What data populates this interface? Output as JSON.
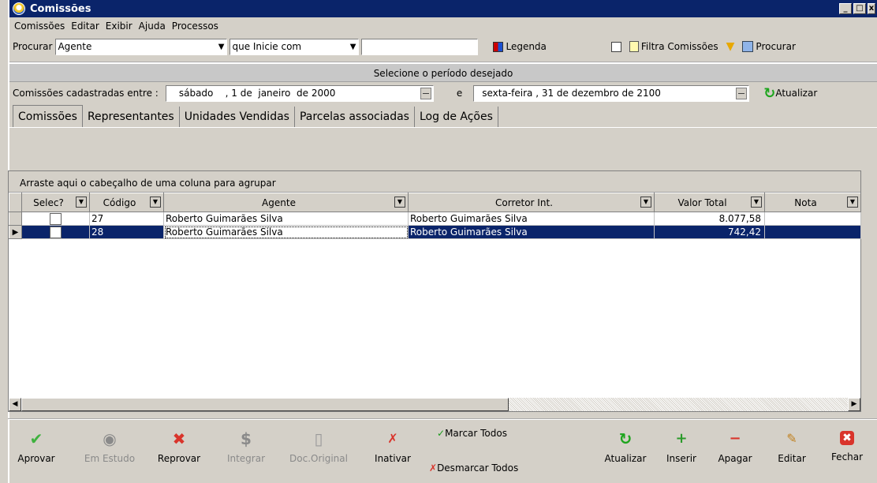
{
  "window": {
    "title": "Comissões"
  },
  "menu": [
    "Comissões",
    "Editar",
    "Exibir",
    "Ajuda",
    "Processos"
  ],
  "search": {
    "label": "Procurar",
    "field": "Agente",
    "condition": "que Inicie com",
    "value": "",
    "legend": "Legenda",
    "filter_label": "Filtra Comissões",
    "search_button": "Procurar"
  },
  "period": {
    "header": "Selecione o período desejado",
    "label": "Comissões cadastradas entre :",
    "from": "sábado    , 1 de  janeiro  de 2000",
    "connector": "e",
    "to": "sexta-feira , 31 de dezembro de 2100",
    "refresh": "Atualizar"
  },
  "tabs": [
    "Comissões",
    "Representantes",
    "Unidades Vendidas",
    "Parcelas associadas",
    "Log de Ações"
  ],
  "grid": {
    "group_hint": "Arraste aqui o cabeçalho de uma coluna para agrupar",
    "columns": [
      "Selec?",
      "Código",
      "Agente",
      "Corretor Int.",
      "Valor Total",
      "Nota"
    ],
    "rows": [
      {
        "codigo": "27",
        "agente": "Roberto Guimarães Silva",
        "corretor": "Roberto Guimarães Silva",
        "valor": "8.077,58",
        "nota": ""
      },
      {
        "codigo": "28",
        "agente": "Roberto Guimarães Silva",
        "corretor": "Roberto Guimarães Silva",
        "valor": "742,42",
        "nota": ""
      }
    ]
  },
  "toolbar": {
    "aprovar": "Aprovar",
    "em_estudo": "Em Estudo",
    "reprovar": "Reprovar",
    "integrar": "Integrar",
    "doc_original": "Doc.Original",
    "inativar": "Inativar",
    "marcar_todos": "Marcar Todos",
    "desmarcar_todos": "Desmarcar Todos",
    "atualizar": "Atualizar",
    "inserir": "Inserir",
    "apagar": "Apagar",
    "editar": "Editar",
    "fechar": "Fechar"
  },
  "colors": {
    "titlebar": "#0a246a",
    "selection": "#0a246a",
    "face": "#d4d0c8"
  }
}
